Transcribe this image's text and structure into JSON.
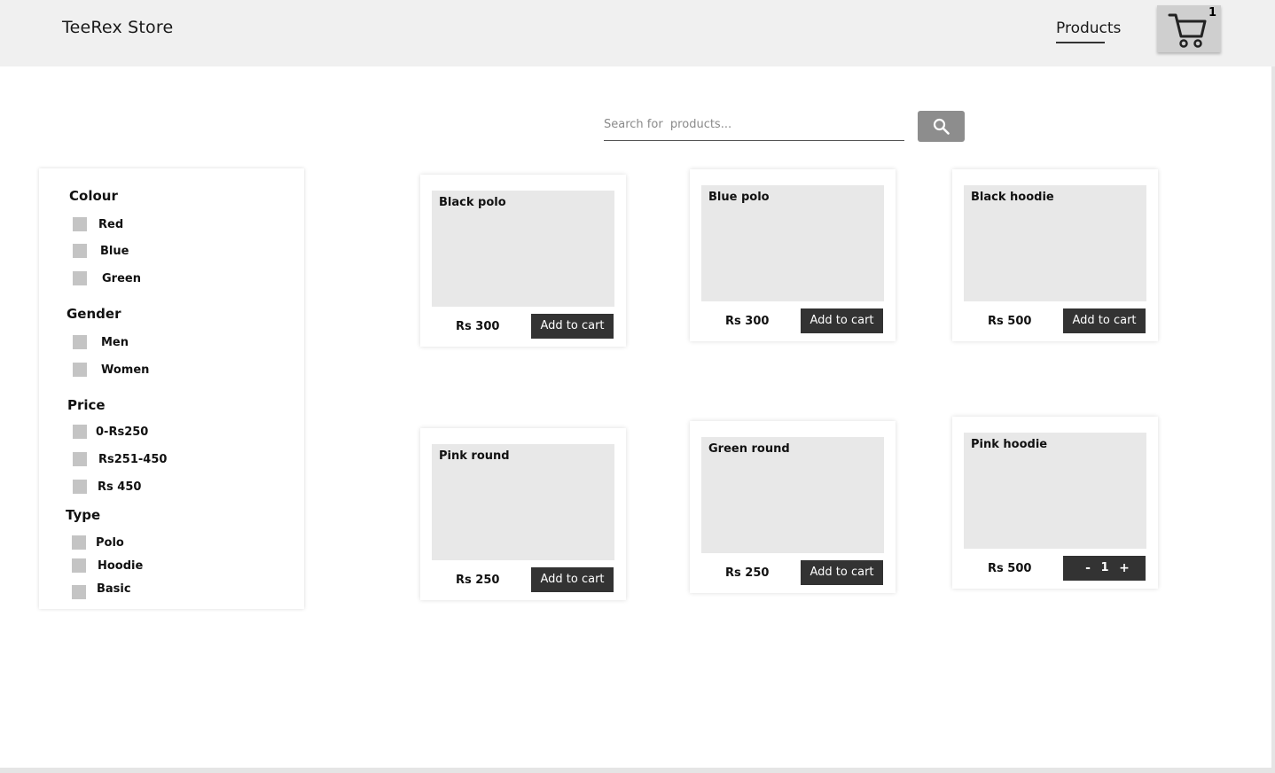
{
  "header": {
    "brand": "TeeRex Store",
    "nav_products": "Products",
    "cart_count": "1",
    "cart_icon": "shopping-cart-icon"
  },
  "search": {
    "placeholder": "Search for  products...",
    "value": "",
    "button_icon": "search-icon"
  },
  "filters": {
    "colour": {
      "title": "Colour",
      "options": [
        "Red",
        "Blue",
        "Green"
      ]
    },
    "gender": {
      "title": "Gender",
      "options": [
        "Men",
        "Women"
      ]
    },
    "price": {
      "title": "Price",
      "options": [
        "0-Rs250",
        "Rs251-450",
        "Rs 450"
      ]
    },
    "type": {
      "title": "Type",
      "options": [
        "Polo",
        "Hoodie",
        "Basic"
      ]
    }
  },
  "products": [
    {
      "name": "Black polo",
      "price": "Rs 300",
      "action": "Add to cart"
    },
    {
      "name": "Blue polo",
      "price": "Rs 300",
      "action": "Add to cart"
    },
    {
      "name": "Black hoodie",
      "price": "Rs 500",
      "action": "Add to cart"
    },
    {
      "name": "Pink round",
      "price": "Rs 250",
      "action": "Add to cart"
    },
    {
      "name": "Green round",
      "price": "Rs 250",
      "action": "Add to cart"
    },
    {
      "name": "Pink hoodie",
      "price": "Rs 500",
      "quantity": "1",
      "minus": "-",
      "plus": "+"
    }
  ],
  "colors": {
    "header_bg": "#f0f0f0",
    "button_dark": "#333333",
    "search_button": "#8d8d8d",
    "checkbox": "#c4c4c4",
    "image_placeholder": "#e8e8e8"
  }
}
